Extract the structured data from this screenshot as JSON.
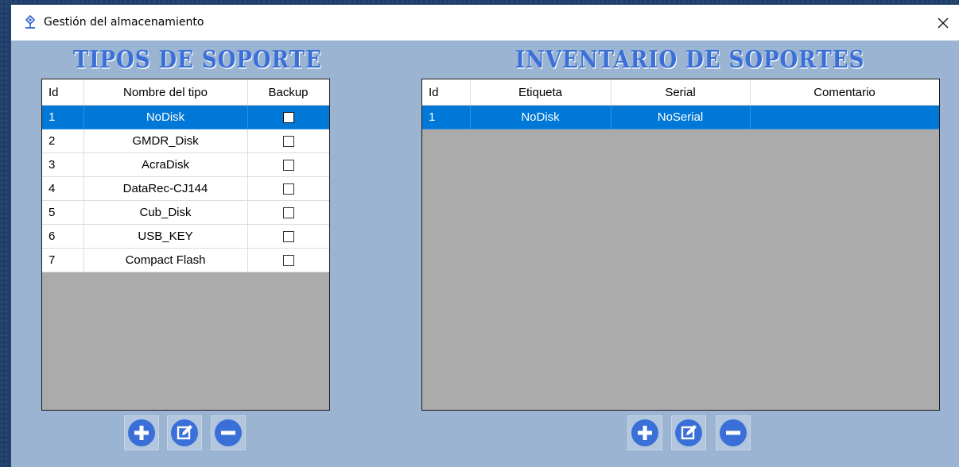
{
  "window": {
    "title": "Gestión del almacenamiento",
    "close_label": "✕"
  },
  "left": {
    "title": "TIPOS DE SOPORTE",
    "columns": [
      "Id",
      "Nombre del tipo",
      "Backup"
    ],
    "rows": [
      {
        "id": "1",
        "name": "NoDisk",
        "backup": false,
        "selected": true
      },
      {
        "id": "2",
        "name": "GMDR_Disk",
        "backup": false,
        "selected": false
      },
      {
        "id": "3",
        "name": "AcraDisk",
        "backup": false,
        "selected": false
      },
      {
        "id": "4",
        "name": "DataRec-CJ144",
        "backup": false,
        "selected": false
      },
      {
        "id": "5",
        "name": "Cub_Disk",
        "backup": false,
        "selected": false
      },
      {
        "id": "6",
        "name": "USB_KEY",
        "backup": false,
        "selected": false
      },
      {
        "id": "7",
        "name": "Compact Flash",
        "backup": false,
        "selected": false
      }
    ],
    "buttons": [
      "add-icon",
      "edit-icon",
      "remove-icon"
    ]
  },
  "right": {
    "title": "INVENTARIO DE SOPORTES",
    "columns": [
      "Id",
      "Etiqueta",
      "Serial",
      "Comentario"
    ],
    "rows": [
      {
        "id": "1",
        "label": "NoDisk",
        "serial": "NoSerial",
        "comment": "",
        "selected": true
      }
    ],
    "buttons": [
      "add-icon",
      "edit-icon",
      "remove-icon"
    ]
  },
  "colors": {
    "accent": "#3a6fd8",
    "selection": "#0078d7",
    "panel_bg": "#9ab4d2",
    "grid_empty": "#ababab"
  }
}
